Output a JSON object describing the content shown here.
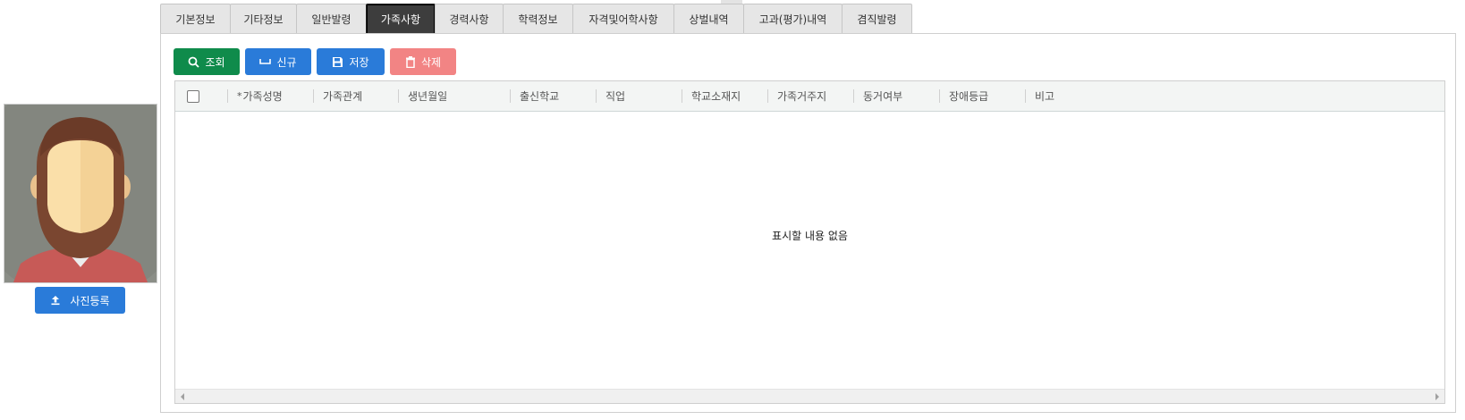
{
  "tabs": [
    {
      "label": "기본정보",
      "width": 79
    },
    {
      "label": "기타정보",
      "width": 75
    },
    {
      "label": "일반발령",
      "width": 79
    },
    {
      "label": "가족사항",
      "width": 78
    },
    {
      "label": "경력사항",
      "width": 77
    },
    {
      "label": "학력정보",
      "width": 79
    },
    {
      "label": "자격및어학사항",
      "width": 114
    },
    {
      "label": "상벌내역",
      "width": 79
    },
    {
      "label": "고과(평가)내역",
      "width": 111
    },
    {
      "label": "겸직발령",
      "width": 79
    }
  ],
  "active_tab": "가족사항",
  "photo": {
    "upload_label": "사진등록"
  },
  "toolbar": {
    "search_label": "조회",
    "new_label": "신규",
    "save_label": "저장",
    "delete_label": "삭제"
  },
  "grid": {
    "columns": [
      {
        "label": "가족성명",
        "required": true
      },
      {
        "label": "가족관계",
        "required": false
      },
      {
        "label": "생년월일",
        "required": false
      },
      {
        "label": "출신학교",
        "required": false
      },
      {
        "label": "직업",
        "required": false
      },
      {
        "label": "학교소재지",
        "required": false
      },
      {
        "label": "가족거주지",
        "required": false
      },
      {
        "label": "동거여부",
        "required": false
      },
      {
        "label": "장애등급",
        "required": false
      },
      {
        "label": "비고",
        "required": false
      }
    ],
    "required_mark": "*",
    "empty_message": "표시할 내용 없음",
    "rows": []
  },
  "colors": {
    "search": "#0f8b4b",
    "primary": "#2a7bd9",
    "delete": "#f28484",
    "active_tab": "#3d3d3d"
  }
}
